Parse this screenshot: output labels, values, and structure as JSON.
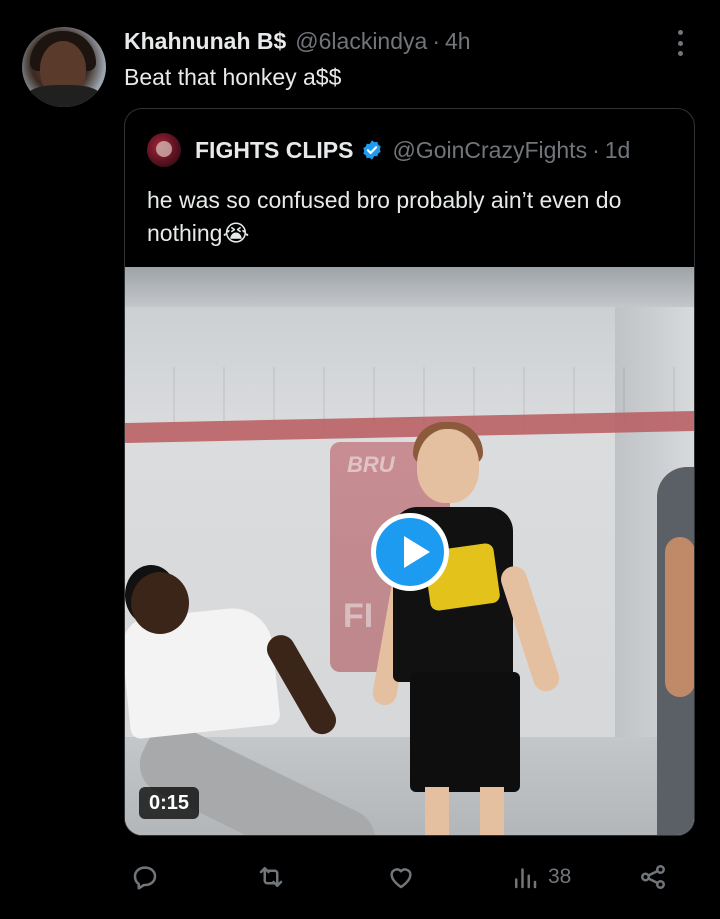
{
  "tweet": {
    "author_name": "Khahnunah B$",
    "author_handle": "@6lackindya",
    "time": "4h",
    "text": "Beat that honkey a$$"
  },
  "quoted_tweet": {
    "author_name": "FIGHTS CLIPS",
    "author_handle": "@GoinCrazyFights",
    "time": "1d",
    "text": "he was so confused bro probably ain’t even do nothing😭",
    "video": {
      "duration": "0:15",
      "banner_text_top": "BRU",
      "banner_text_bottom": "FI"
    }
  },
  "actions": {
    "views_count": "38",
    "icons": [
      "reply-icon",
      "retweet-icon",
      "like-icon",
      "views-icon",
      "share-icon"
    ]
  },
  "colors": {
    "background": "#000000",
    "text": "#e7e9ea",
    "muted": "#71767b",
    "accent": "#1d9bf0"
  }
}
